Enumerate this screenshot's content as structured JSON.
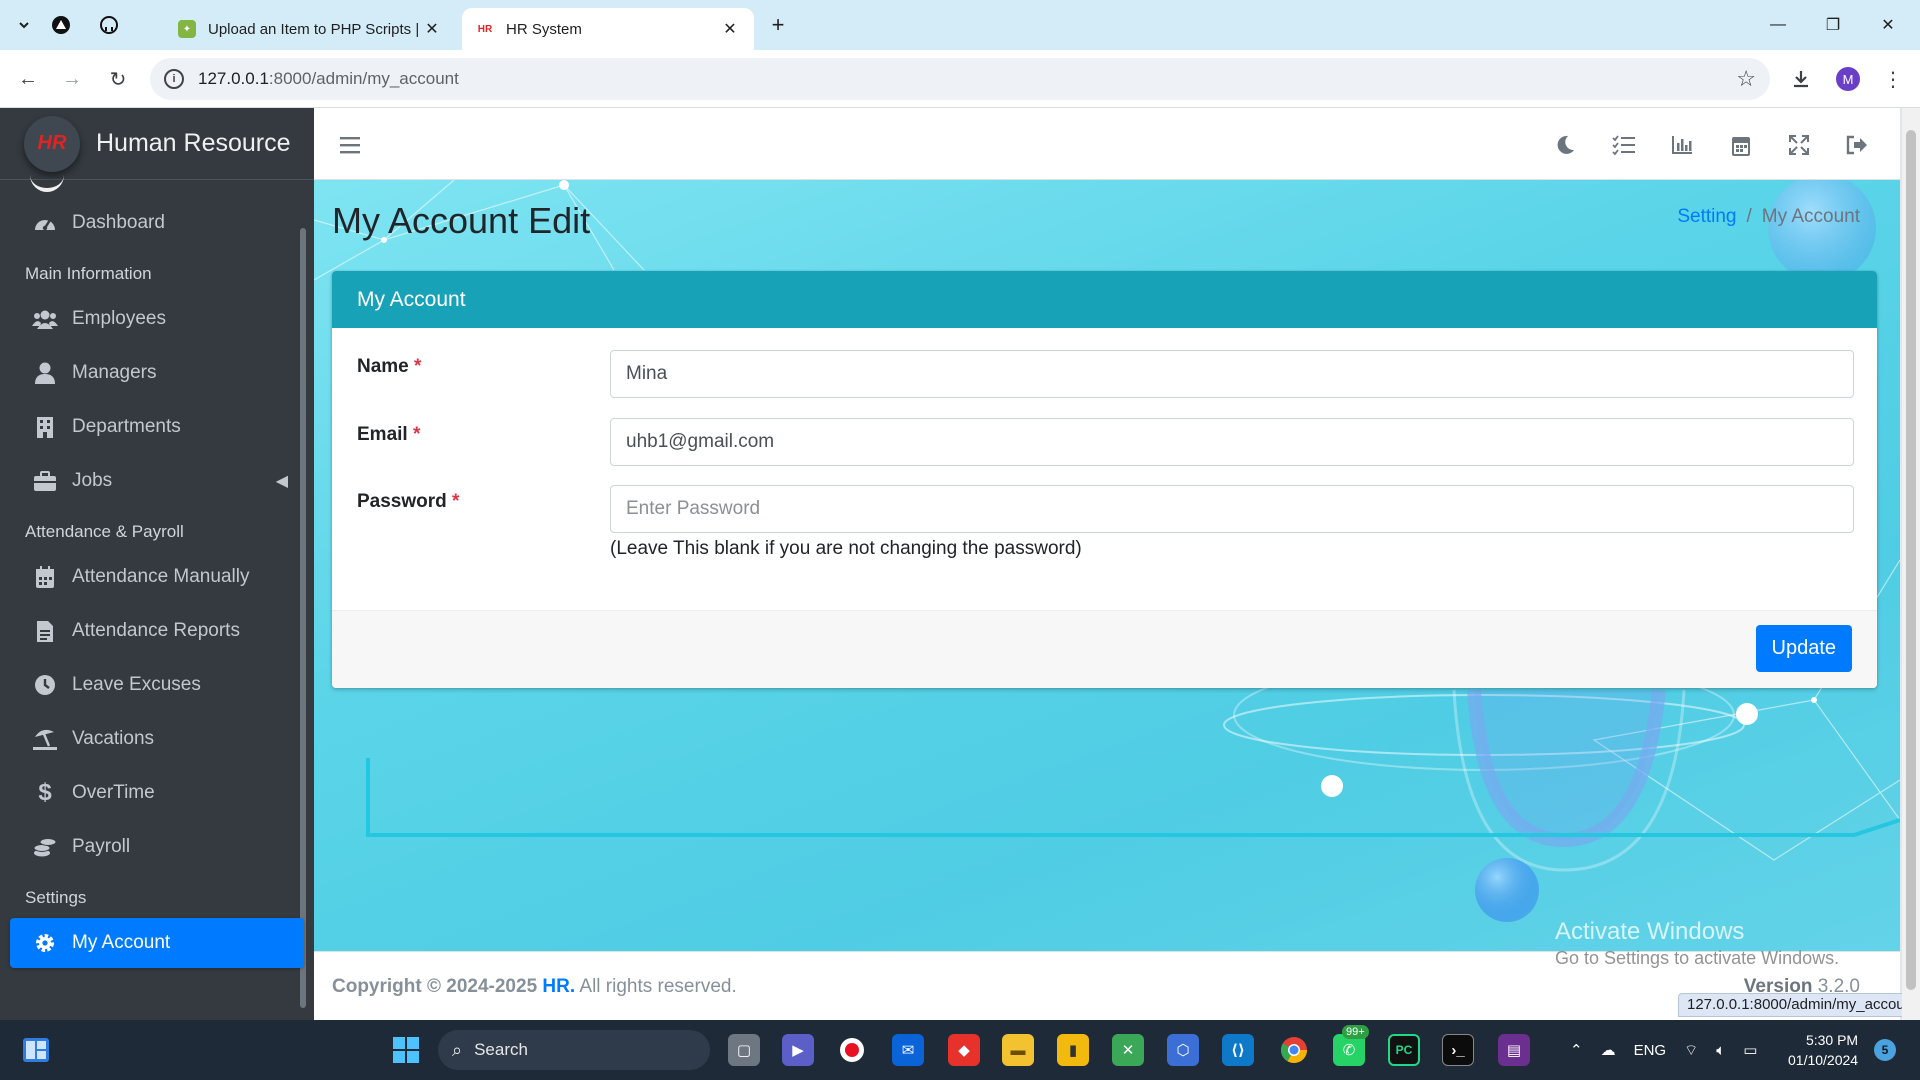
{
  "browser": {
    "tabs": [
      {
        "title": "Upload an Item to PHP Scripts |",
        "active": false
      },
      {
        "title": "HR System",
        "active": true
      }
    ],
    "new_tab": "+",
    "url_host": "127.0.0.1",
    "url_path": ":8000/admin/my_account",
    "profile_initial": "M",
    "status_url": "127.0.0.1:8000/admin/my_account"
  },
  "sidebar": {
    "brand": "Human Resource",
    "logo_text": "HR",
    "items_top": [
      {
        "label": "Dashboard",
        "icon": "dashboard-icon"
      }
    ],
    "section_main": "Main Information",
    "items_main": [
      {
        "label": "Employees",
        "icon": "users-icon"
      },
      {
        "label": "Managers",
        "icon": "user-icon"
      },
      {
        "label": "Departments",
        "icon": "building-icon"
      },
      {
        "label": "Jobs",
        "icon": "briefcase-icon"
      }
    ],
    "section_attendance": "Attendance & Payroll",
    "items_attendance": [
      {
        "label": "Attendance Manually",
        "icon": "calendar-icon"
      },
      {
        "label": "Attendance Reports",
        "icon": "file-icon"
      },
      {
        "label": "Leave Excuses",
        "icon": "clock-icon"
      },
      {
        "label": "Vacations",
        "icon": "umbrella-beach-icon"
      },
      {
        "label": "OverTime",
        "icon": "dollar-icon"
      },
      {
        "label": "Payroll",
        "icon": "coins-icon"
      }
    ],
    "section_settings": "Settings",
    "items_settings": [
      {
        "label": "My Account",
        "icon": "gear-icon",
        "active": true
      }
    ]
  },
  "page": {
    "title": "My Account Edit",
    "breadcrumb": {
      "link": "Setting",
      "separator": "/",
      "current": "My Account"
    }
  },
  "card": {
    "header": "My Account",
    "fields": {
      "name": {
        "label": "Name",
        "required": "*",
        "value": "Mina"
      },
      "email": {
        "label": "Email",
        "required": "*",
        "value": "uhb1@gmail.com"
      },
      "password": {
        "label": "Password",
        "required": "*",
        "placeholder": "Enter Password",
        "help": "(Leave This blank if you are not changing the password)"
      }
    },
    "submit": "Update"
  },
  "footer": {
    "copyright_prefix": "Copyright © 2024-2025",
    "brand": "HR.",
    "suffix": "All rights reserved.",
    "version_label": "Version",
    "version": "3.2.0"
  },
  "watermark": {
    "line1": "Activate Windows",
    "line2": "Go to Settings to activate Windows."
  },
  "taskbar": {
    "search": "Search",
    "language": "ENG",
    "time": "5:30 PM",
    "date": "01/10/2024",
    "notifications": "5",
    "whatsapp_badge": "99+"
  },
  "colors": {
    "sidebar_bg": "#343a40",
    "active_blue": "#007bff",
    "card_header": "#17a2b8",
    "required": "#dc3545"
  }
}
